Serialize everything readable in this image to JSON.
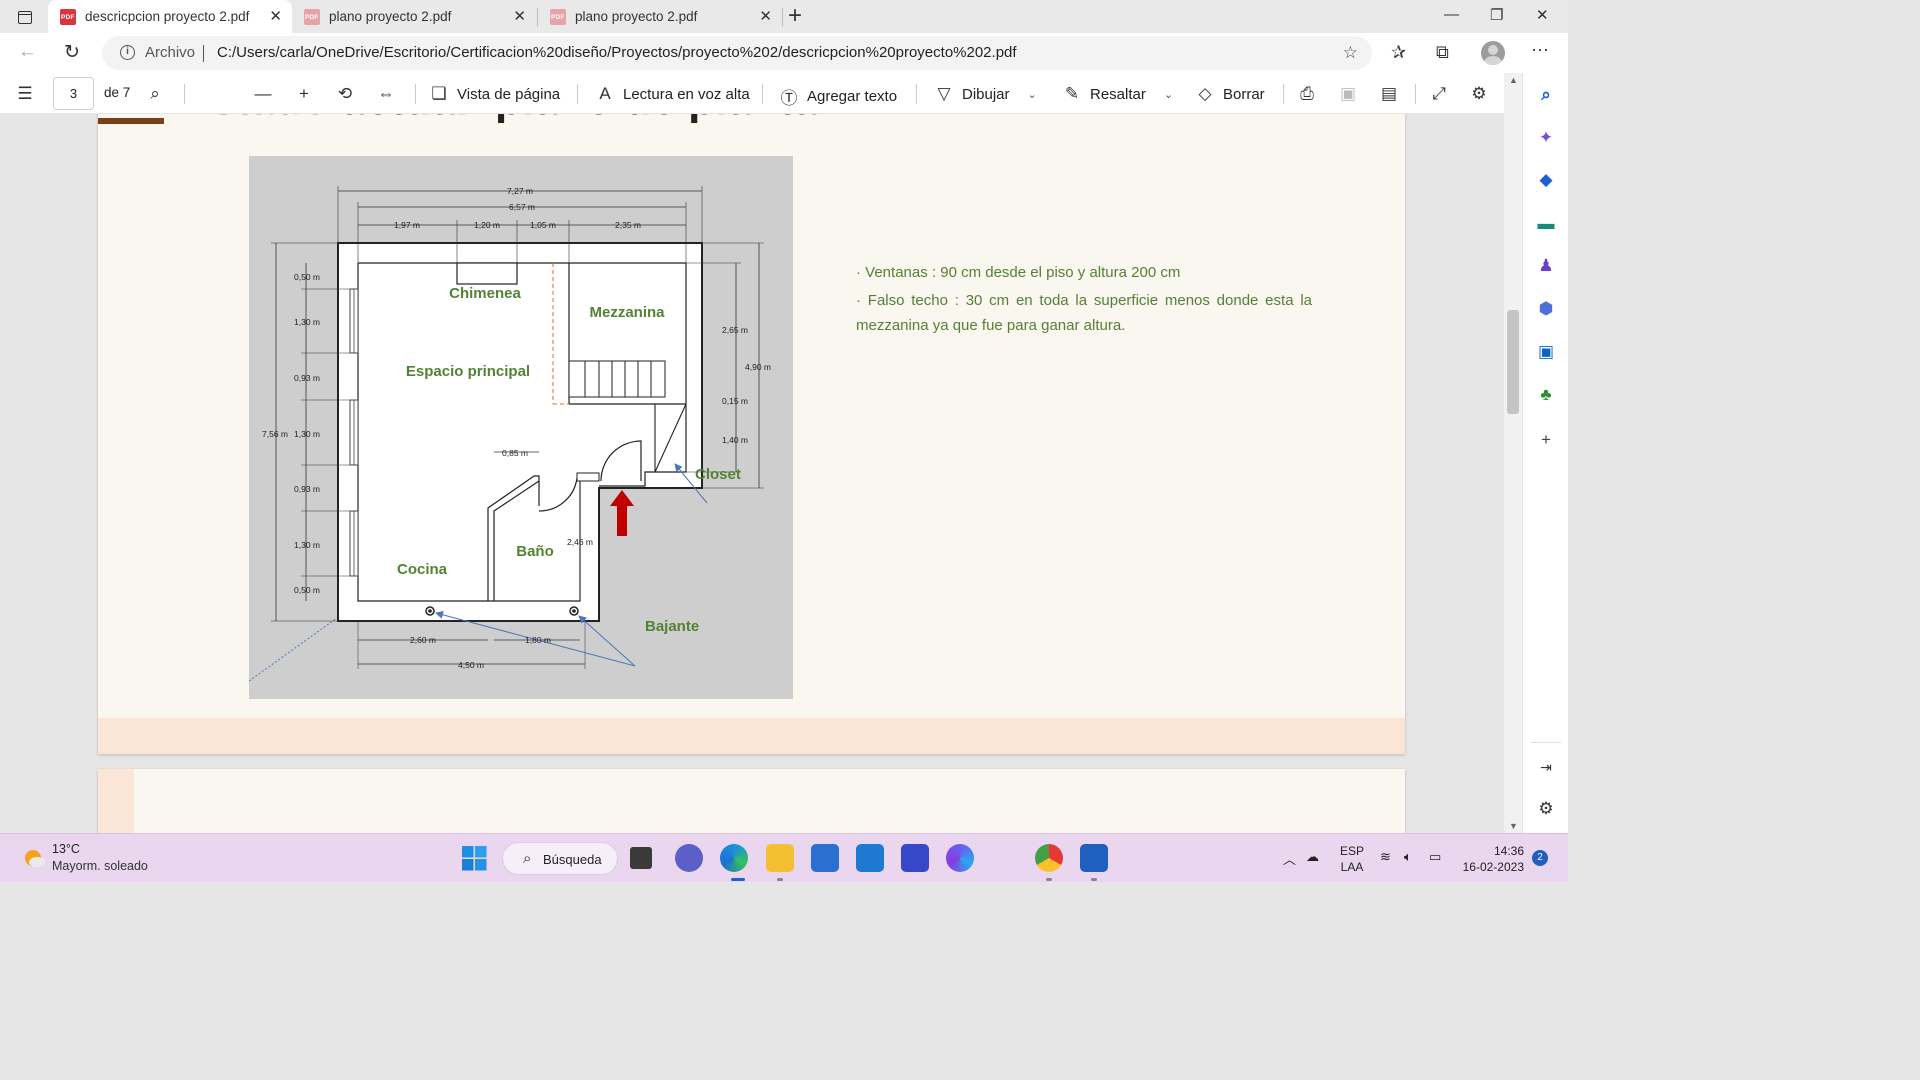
{
  "tabs": [
    {
      "title": "descricpcion proyecto 2.pdf",
      "active": true
    },
    {
      "title": "plano proyecto 2.pdf",
      "active": false
    },
    {
      "title": "plano proyecto 2.pdf",
      "active": false
    }
  ],
  "address": {
    "scheme_label": "Archivo",
    "url": "C:/Users/carla/OneDrive/Escritorio/Certificacion%20diseño/Proyectos/proyecto%202/descricpcion%20proyecto%202.pdf"
  },
  "pdf_toolbar": {
    "page_current": "3",
    "page_total": "de 7",
    "page_view": "Vista de página",
    "read_aloud": "Lectura en voz alta",
    "add_text": "Agregar texto",
    "draw": "Dibujar",
    "highlight": "Resaltar",
    "erase": "Borrar"
  },
  "document": {
    "title_word1": "Estado",
    "title_rest": "actual: plano de planta",
    "notes": [
      "· Ventanas : 90 cm desde el piso y altura 200 cm",
      "· Falso techo : 30 cm en toda la superficie menos donde esta la mezzanina ya que fue para ganar altura."
    ],
    "plan": {
      "rooms": {
        "chimenea": "Chimenea",
        "mezzanina": "Mezzanina",
        "espacio": "Espacio principal",
        "cocina": "Cocina",
        "bano": "Baño",
        "closet": "Closet",
        "bajante": "Bajante"
      },
      "dims": {
        "d727": "7,27 m",
        "d657": "6,57 m",
        "d197": "1,97 m",
        "d120": "1,20 m",
        "d105": "1,05 m",
        "d235": "2,35 m",
        "d050a": "0,50 m",
        "d130a": "1,30 m",
        "d093a": "0,93 m",
        "d756": "7,56 m",
        "d130b": "1,30 m",
        "d093b": "0,93 m",
        "d130c": "1,30 m",
        "d050b": "0,50 m",
        "d265": "2,65 m",
        "d490": "4,90 m",
        "d015": "0,15 m",
        "d140": "1,40 m",
        "d085": "0,85 m",
        "d246": "2,46 m",
        "d260": "2,60 m",
        "d180": "1,80 m",
        "d450": "4,50 m"
      }
    }
  },
  "taskbar": {
    "temperature": "13°C",
    "weather": "Mayorm. soleado",
    "search": "Búsqueda",
    "lang1": "ESP",
    "lang2": "LAA",
    "time": "14:36",
    "date": "16-02-2023",
    "notifications": "2"
  },
  "colors": {
    "accent_green": "#548235",
    "title_brown": "#a47a4f",
    "edge_blue": "#0c59a4"
  }
}
